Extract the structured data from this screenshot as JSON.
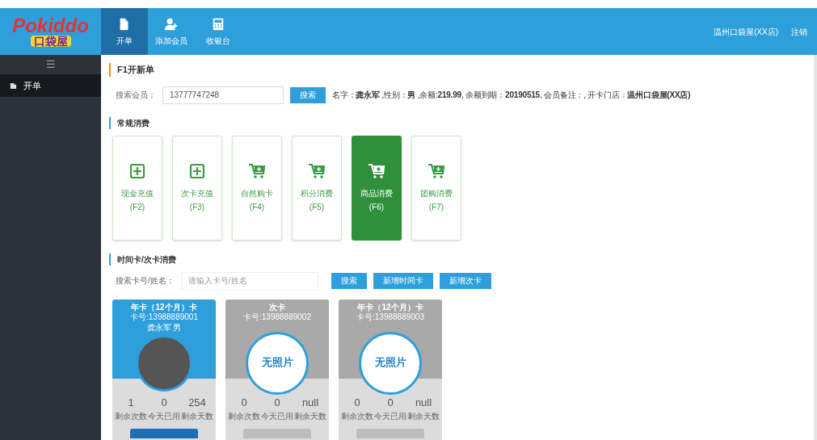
{
  "header": {
    "logo": "Pokiddo",
    "logo_subtitle": "口袋屋",
    "nav": [
      {
        "label": "开单",
        "selected": true
      },
      {
        "label": "添加会员",
        "selected": false
      },
      {
        "label": "收银台",
        "selected": false
      }
    ],
    "user_links": [
      "温州口袋屋(XX店)",
      "注销"
    ]
  },
  "sidebar": {
    "toggle": "☰",
    "items": [
      {
        "label": "开单",
        "selected": true
      }
    ]
  },
  "page_title": "F1开新单",
  "member_search": {
    "label": "搜索会员：",
    "value": "13777747248",
    "button": "搜索",
    "info": "名字：**龚永军** ,性别：**男** ,余额:**219.99**, 余额到期：**20190515**, 会员备注：, 开卡门店：**温州口袋屋(XX店)**"
  },
  "regular_section": {
    "title": "常规消费",
    "tiles": [
      {
        "kind": "recharge",
        "label": "现金充值",
        "key": "(F2)",
        "selected": false
      },
      {
        "kind": "recharge",
        "label": "次卡充值",
        "key": "(F3)",
        "selected": false
      },
      {
        "kind": "purchase",
        "label": "自然购卡",
        "key": "(F4)",
        "selected": false
      },
      {
        "kind": "purchase",
        "label": "积分消费",
        "key": "(F5)",
        "selected": false
      },
      {
        "kind": "purchase",
        "label": "商品消费",
        "key": "(F6)",
        "selected": true
      },
      {
        "kind": "purchase",
        "label": "团购消费",
        "key": "(F7)",
        "selected": false
      }
    ]
  },
  "card_section": {
    "title": "时间卡/次卡消费",
    "search_label": "搜索卡号/姓名：",
    "placeholder": "请输入卡号/姓名",
    "buttons": [
      "搜索",
      "新增时间卡",
      "新增次卡"
    ],
    "cards": [
      {
        "active": true,
        "title": "年卡（12个月）卡",
        "lines": [
          "卡号:13988889001",
          "龚永军 男"
        ],
        "photo": true,
        "stats": [
          {
            "value": "1",
            "label": "剩余次数"
          },
          {
            "value": "0",
            "label": "今天已用"
          },
          {
            "value": "254",
            "label": "剩余天数"
          }
        ]
      },
      {
        "active": false,
        "title": "次卡",
        "lines": [
          "卡号:13988889002"
        ],
        "photo": false,
        "photo_text": "无照片",
        "stats": [
          {
            "value": "0",
            "label": "剩余次数"
          },
          {
            "value": "0",
            "label": "今天已用"
          },
          {
            "value": "null",
            "label": "剩余天数"
          }
        ]
      },
      {
        "active": false,
        "title": "年卡（12个月）卡",
        "lines": [
          "卡号:13988889003"
        ],
        "photo": false,
        "photo_text": "无照片",
        "stats": [
          {
            "value": "0",
            "label": "剩余次数"
          },
          {
            "value": "0",
            "label": "今天已用"
          },
          {
            "value": "null",
            "label": "剩余天数"
          }
        ]
      }
    ]
  }
}
